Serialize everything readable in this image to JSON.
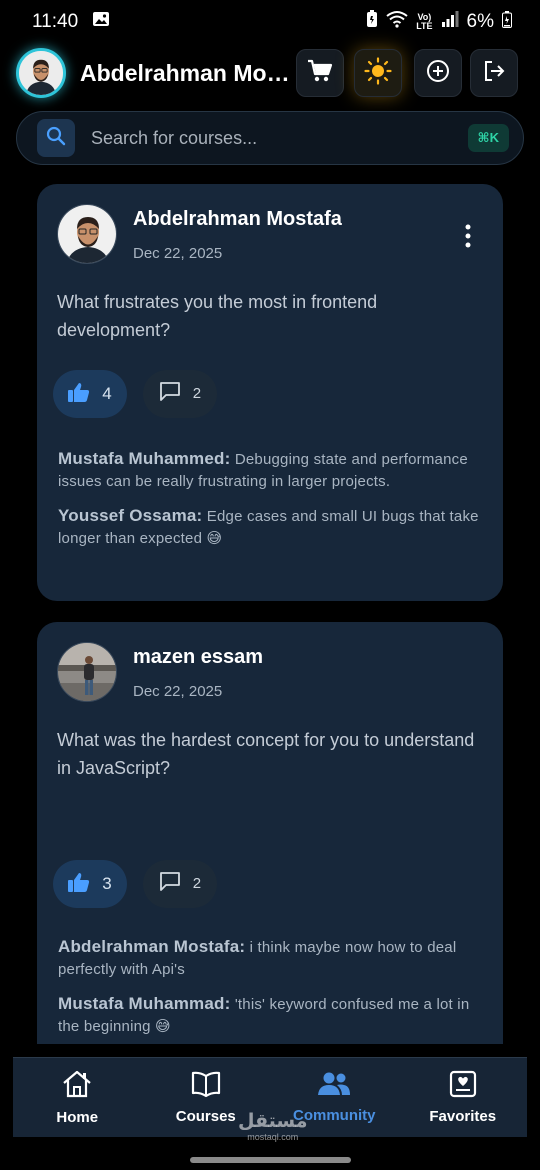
{
  "status_bar": {
    "time": "11:40",
    "lte_label": "Vo)\nLTE",
    "battery": "6%"
  },
  "header": {
    "user_name": "Abdelrahman Mostafa",
    "icons": [
      "cart-icon",
      "sun-icon",
      "add-icon",
      "logout-icon"
    ]
  },
  "search": {
    "placeholder": "Search for courses...",
    "shortcut": "⌘K"
  },
  "posts": [
    {
      "author": "Abdelrahman Mostafa",
      "date": "Dec 22, 2025",
      "text": "What frustrates you the most in frontend development?",
      "likes": "4",
      "comments_count": "2",
      "comments": [
        {
          "author": "Mustafa Muhammed:",
          "text": " Debugging state and performance issues can be really frustrating in larger projects."
        },
        {
          "author": "Youssef  Ossama:",
          "text": " Edge cases and small UI bugs that take longer than expected 😅"
        }
      ]
    },
    {
      "author": "mazen essam",
      "date": "Dec 22, 2025",
      "text": "What was the hardest concept for you to understand in JavaScript?",
      "likes": "3",
      "comments_count": "2",
      "comments": [
        {
          "author": "Abdelrahman Mostafa:",
          "text": " i think maybe now how to deal perfectly with Api's"
        },
        {
          "author": "Mustafa Muhammad:",
          "text": " 'this' keyword confused me a lot in the beginning 😅"
        }
      ]
    }
  ],
  "bottom_nav": {
    "items": [
      {
        "label": "Home",
        "icon": "home-icon"
      },
      {
        "label": "Courses",
        "icon": "book-icon"
      },
      {
        "label": "Community",
        "icon": "community-icon",
        "active": true
      },
      {
        "label": "Favorites",
        "icon": "favorites-icon"
      }
    ]
  },
  "watermark": {
    "arabic": "مستقل",
    "latin": "mostaql.com"
  },
  "colors": {
    "accent": "#4a8fe0",
    "card": "#17273a",
    "background": "#000000",
    "avatar_ring": "#2ec4d9",
    "sun": "#ffb81c"
  }
}
